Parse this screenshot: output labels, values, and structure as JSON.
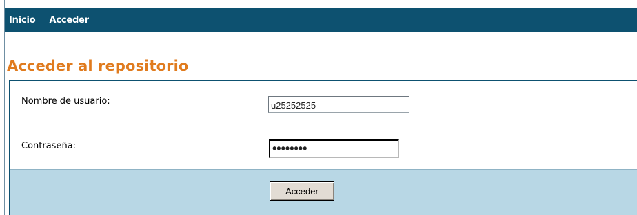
{
  "nav": {
    "items": [
      {
        "label": "Inicio"
      },
      {
        "label": "Acceder"
      }
    ]
  },
  "page": {
    "title": "Acceder al repositorio"
  },
  "form": {
    "username_label": "Nombre de usuario:",
    "username_value": "u25252525",
    "password_label": "Contraseña:",
    "password_value": "12345678",
    "submit_label": "Acceder"
  },
  "colors": {
    "nav_background": "#0d5170",
    "title_color": "#e07b1e",
    "submit_row_background": "#b8d7e5",
    "border_color": "#0d5170"
  }
}
